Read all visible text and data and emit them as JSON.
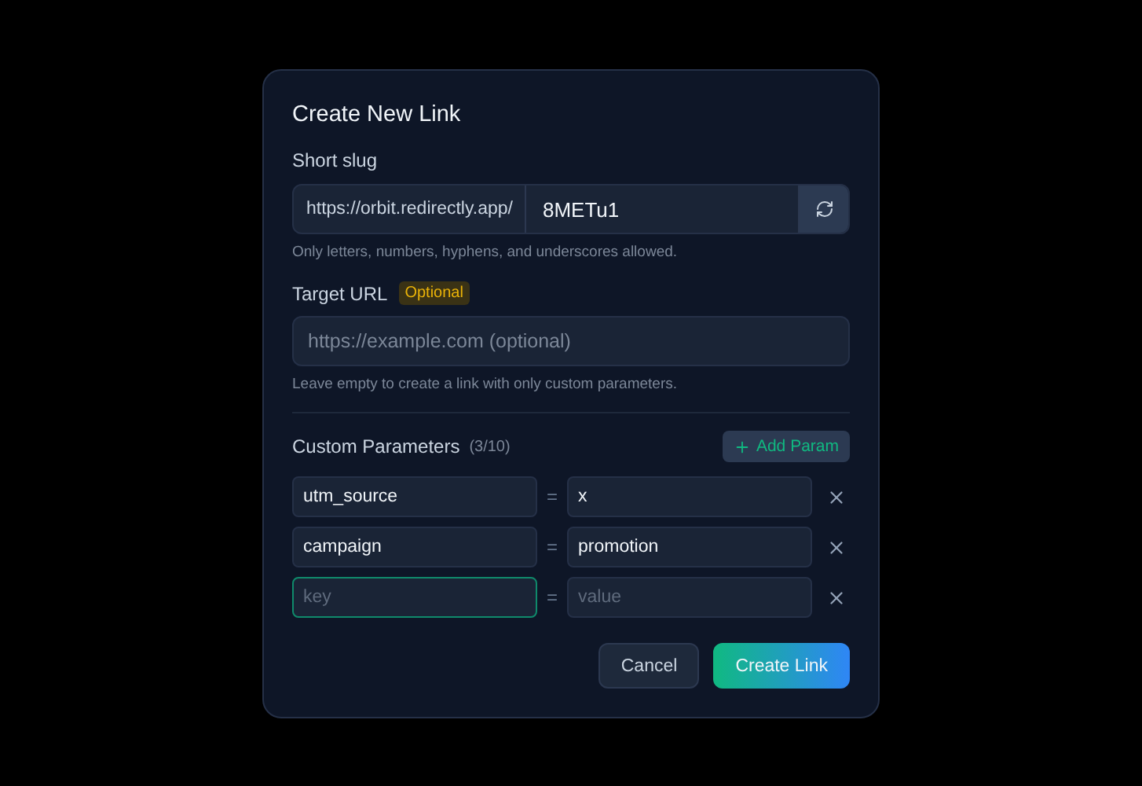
{
  "dialog": {
    "title": "Create New Link",
    "slug": {
      "label": "Short slug",
      "prefix": "https://orbit.redirectly.app/",
      "value": "8METu1",
      "hint": "Only letters, numbers, hyphens, and underscores allowed."
    },
    "target_url": {
      "label": "Target URL",
      "badge": "Optional",
      "placeholder": "https://example.com (optional)",
      "hint": "Leave empty to create a link with only custom parameters."
    },
    "custom_parameters": {
      "label": "Custom Parameters",
      "count": "(3/10)",
      "add_button": "Add Param",
      "rows": [
        {
          "key": "utm_source",
          "equals": "=",
          "value": "x",
          "focused": false
        },
        {
          "key": "campaign",
          "equals": "=",
          "value": "promotion",
          "focused": false
        },
        {
          "key_placeholder": "key",
          "equals": "=",
          "value_placeholder": "value",
          "focused": true
        }
      ]
    },
    "buttons": [
      {
        "label": "Cancel",
        "kind": "secondary"
      },
      {
        "label": "Create Link",
        "kind": "primary"
      }
    ]
  }
}
